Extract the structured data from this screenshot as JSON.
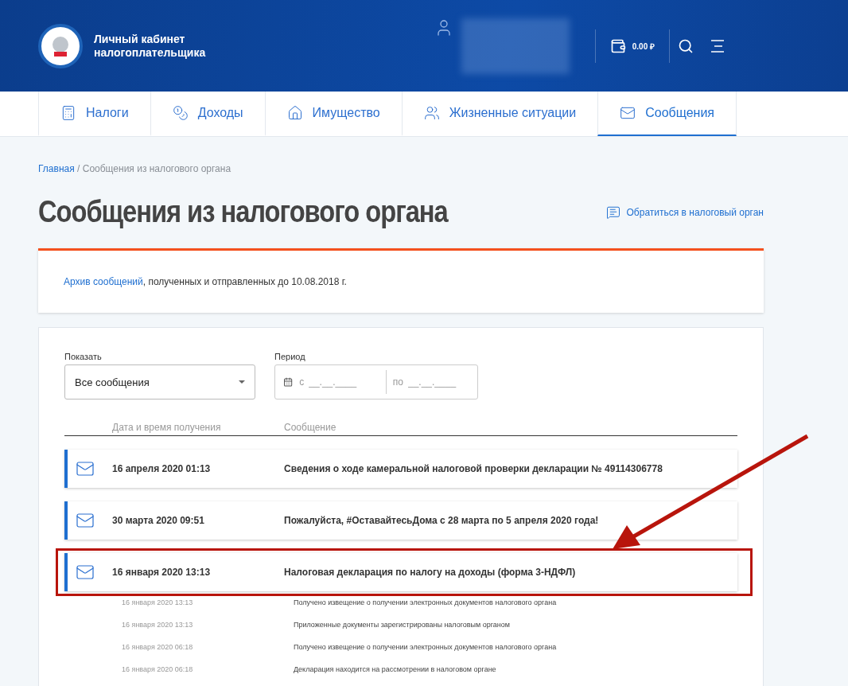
{
  "header": {
    "brand": [
      "Личный кабинет",
      "налогоплательщика"
    ],
    "balance": "0.00 ₽"
  },
  "nav": [
    {
      "label": "Налоги",
      "selected": false
    },
    {
      "label": "Доходы",
      "selected": false
    },
    {
      "label": "Имущество",
      "selected": false
    },
    {
      "label": "Жизненные ситуации",
      "selected": false
    },
    {
      "label": "Сообщения",
      "selected": true
    }
  ],
  "breadcrumb": {
    "link": "Главная",
    "separator": "/",
    "current": "Сообщения из налогового органа"
  },
  "title": "Сообщения из налогового органа",
  "contact_link": "Обратиться в налоговый орган",
  "archive": {
    "link": "Архив сообщений",
    "text": ", полученных и отправленных до 10.08.2018 г."
  },
  "filters": {
    "show_label": "Показать",
    "show_value": "Все сообщения",
    "period_label": "Период",
    "from_prefix": "с",
    "from_placeholder": "__.__.____",
    "to_prefix": "по",
    "to_placeholder": "__.__.____"
  },
  "table": {
    "columns": [
      "Дата и время получения",
      "Сообщение"
    ],
    "rows": [
      {
        "date": "16 апреля 2020 01:13",
        "message": "Сведения о ходе камеральной налоговой проверки декларации № 49114306778",
        "highlighted": false
      },
      {
        "date": "30 марта 2020 09:51",
        "message": "Пожалуйста, #ОставайтесьДома с 28 марта по 5 апреля 2020 года!",
        "highlighted": false
      },
      {
        "date": "16 января 2020 13:13",
        "message": "Налоговая декларация по налогу на доходы (форма 3-НДФЛ)",
        "highlighted": true,
        "events": [
          {
            "date": "16 января 2020 13:13",
            "text": "Получено извещение о получении электронных документов налогового органа"
          },
          {
            "date": "16 января 2020 13:13",
            "text": "Приложенные документы зарегистрированы налоговым органом"
          },
          {
            "date": "16 января 2020 06:18",
            "text": "Получено извещение о получении электронных документов налогового органа"
          },
          {
            "date": "16 января 2020 06:18",
            "text": "Декларация находится на рассмотрении в налоговом органе"
          }
        ]
      }
    ]
  }
}
